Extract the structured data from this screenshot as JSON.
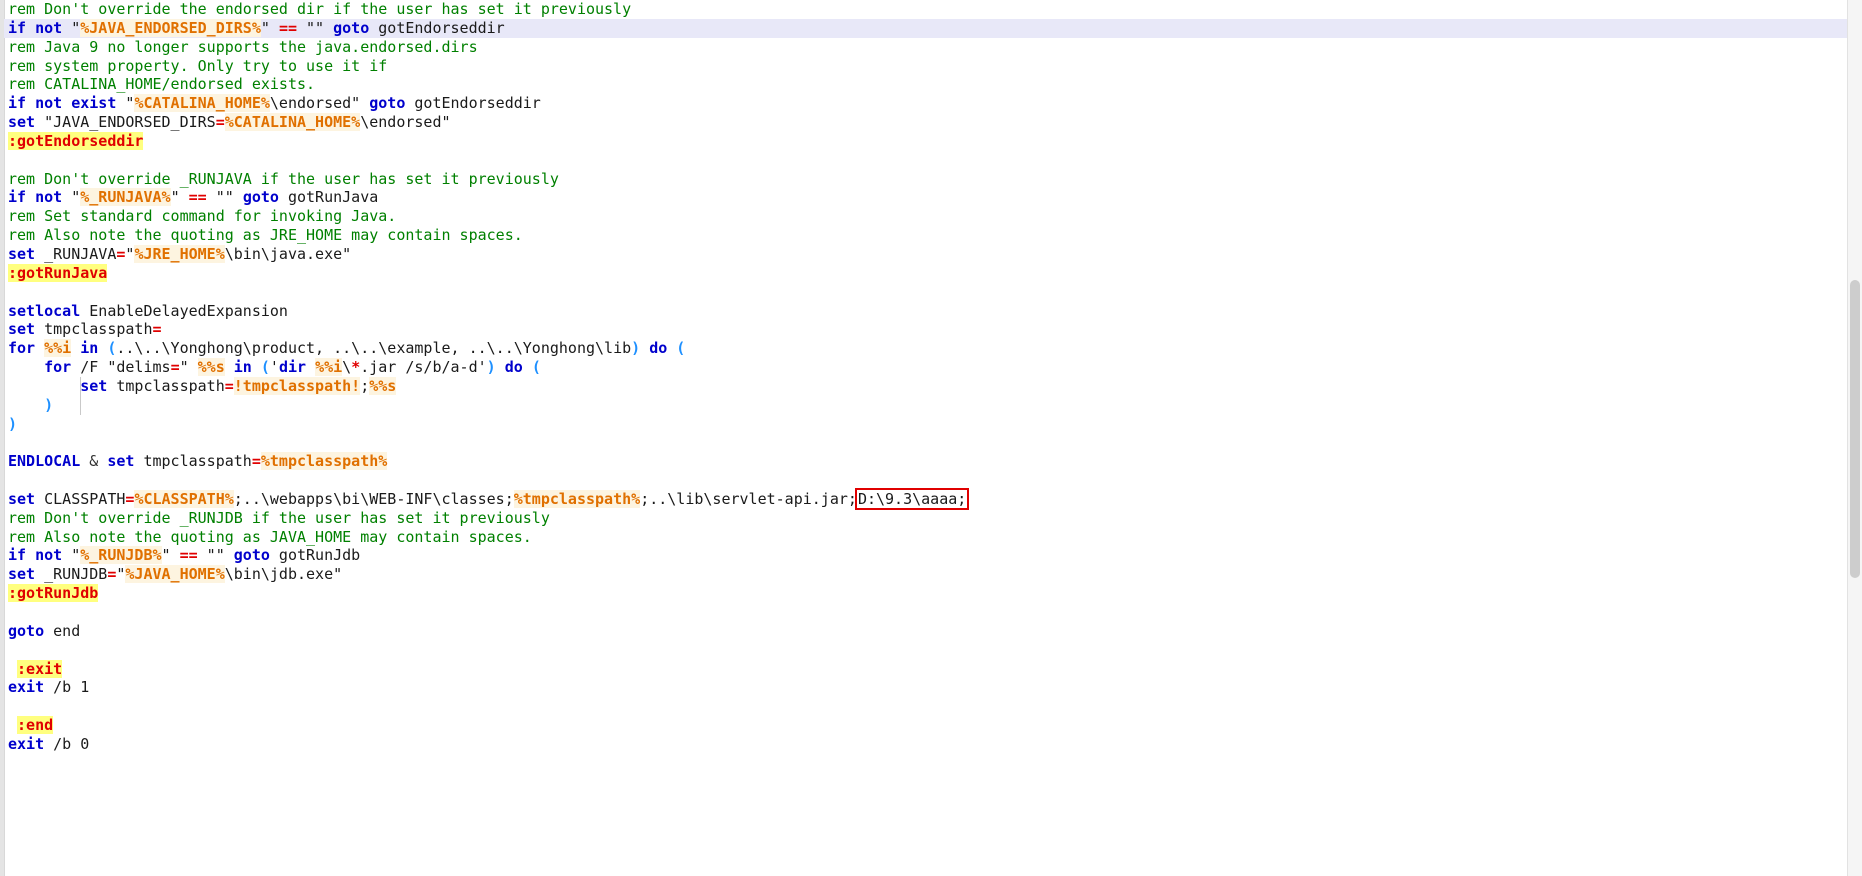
{
  "editor": {
    "language": "batch",
    "filename_hint": "",
    "colors": {
      "keyword": "#0000cc",
      "comment": "#008000",
      "operator": "#e00000",
      "variable": "#e07000",
      "variable_bg": "#fdf4e0",
      "label": "#e00000",
      "label_bg": "#ffff7f",
      "paren": "#1e90ff",
      "plain": "#1a1a1a",
      "current_line_bg": "#e8e8f8",
      "annotation_box": "#e00000",
      "background": "#ffffff",
      "gutter": "#e4e4e4"
    },
    "annotation": {
      "boxed_text": "D:\\9.3\\aaaa;",
      "box_color": "#e00000"
    },
    "scrollbar": {
      "visible": true,
      "thumb_top_pct": 32,
      "thumb_height_pct": 34
    }
  },
  "lines": [
    {
      "id": 1,
      "current": false,
      "tokens": [
        {
          "t": "rem Don't override the endorsed dir if the user has set it previously",
          "c": "t-rem"
        }
      ]
    },
    {
      "id": 2,
      "current": true,
      "tokens": [
        {
          "t": "if",
          "c": "t-kw"
        },
        {
          "t": " ",
          "c": "t-plain"
        },
        {
          "t": "not",
          "c": "t-kw"
        },
        {
          "t": " \"",
          "c": "t-plain"
        },
        {
          "t": "%JAVA_ENDORSED_DIRS%",
          "c": "t-var"
        },
        {
          "t": "\" ",
          "c": "t-plain"
        },
        {
          "t": "==",
          "c": "t-op"
        },
        {
          "t": " \"\" ",
          "c": "t-plain"
        },
        {
          "t": "goto",
          "c": "t-kw"
        },
        {
          "t": " gotEndorseddir",
          "c": "t-plain"
        }
      ]
    },
    {
      "id": 3,
      "current": false,
      "tokens": [
        {
          "t": "rem Java 9 no longer supports the java.endorsed.dirs",
          "c": "t-rem"
        }
      ]
    },
    {
      "id": 4,
      "current": false,
      "tokens": [
        {
          "t": "rem system property. Only try to use it if",
          "c": "t-rem"
        }
      ]
    },
    {
      "id": 5,
      "current": false,
      "tokens": [
        {
          "t": "rem CATALINA_HOME/endorsed exists.",
          "c": "t-rem"
        }
      ]
    },
    {
      "id": 6,
      "current": false,
      "tokens": [
        {
          "t": "if",
          "c": "t-kw"
        },
        {
          "t": " ",
          "c": "t-plain"
        },
        {
          "t": "not",
          "c": "t-kw"
        },
        {
          "t": " ",
          "c": "t-plain"
        },
        {
          "t": "exist",
          "c": "t-kw"
        },
        {
          "t": " \"",
          "c": "t-plain"
        },
        {
          "t": "%CATALINA_HOME%",
          "c": "t-var"
        },
        {
          "t": "\\endorsed\" ",
          "c": "t-plain"
        },
        {
          "t": "goto",
          "c": "t-kw"
        },
        {
          "t": " gotEndorseddir",
          "c": "t-plain"
        }
      ]
    },
    {
      "id": 7,
      "current": false,
      "tokens": [
        {
          "t": "set",
          "c": "t-kw"
        },
        {
          "t": " \"JAVA_ENDORSED_DIRS",
          "c": "t-plain"
        },
        {
          "t": "=",
          "c": "t-op"
        },
        {
          "t": "%CATALINA_HOME%",
          "c": "t-var"
        },
        {
          "t": "\\endorsed\"",
          "c": "t-plain"
        }
      ]
    },
    {
      "id": 8,
      "current": false,
      "tokens": [
        {
          "t": ":gotEndorseddir",
          "c": "t-label"
        }
      ]
    },
    {
      "id": 9,
      "current": false,
      "tokens": []
    },
    {
      "id": 10,
      "current": false,
      "tokens": [
        {
          "t": "rem Don't override _RUNJAVA if the user has set it previously",
          "c": "t-rem"
        }
      ]
    },
    {
      "id": 11,
      "current": false,
      "tokens": [
        {
          "t": "if",
          "c": "t-kw"
        },
        {
          "t": " ",
          "c": "t-plain"
        },
        {
          "t": "not",
          "c": "t-kw"
        },
        {
          "t": " \"",
          "c": "t-plain"
        },
        {
          "t": "%_RUNJAVA%",
          "c": "t-var"
        },
        {
          "t": "\" ",
          "c": "t-plain"
        },
        {
          "t": "==",
          "c": "t-op"
        },
        {
          "t": " \"\" ",
          "c": "t-plain"
        },
        {
          "t": "goto",
          "c": "t-kw"
        },
        {
          "t": " gotRunJava",
          "c": "t-plain"
        }
      ]
    },
    {
      "id": 12,
      "current": false,
      "tokens": [
        {
          "t": "rem Set standard command for invoking Java.",
          "c": "t-rem"
        }
      ]
    },
    {
      "id": 13,
      "current": false,
      "tokens": [
        {
          "t": "rem Also note the quoting as JRE_HOME may contain spaces.",
          "c": "t-rem"
        }
      ]
    },
    {
      "id": 14,
      "current": false,
      "tokens": [
        {
          "t": "set",
          "c": "t-kw"
        },
        {
          "t": " _RUNJAVA",
          "c": "t-plain"
        },
        {
          "t": "=",
          "c": "t-op"
        },
        {
          "t": "\"",
          "c": "t-plain"
        },
        {
          "t": "%JRE_HOME%",
          "c": "t-var"
        },
        {
          "t": "\\bin\\java.exe\"",
          "c": "t-plain"
        }
      ]
    },
    {
      "id": 15,
      "current": false,
      "tokens": [
        {
          "t": ":gotRunJava",
          "c": "t-label"
        }
      ]
    },
    {
      "id": 16,
      "current": false,
      "tokens": []
    },
    {
      "id": 17,
      "current": false,
      "tokens": [
        {
          "t": "setlocal",
          "c": "t-kw"
        },
        {
          "t": " EnableDelayedExpansion",
          "c": "t-plain"
        }
      ]
    },
    {
      "id": 18,
      "current": false,
      "tokens": [
        {
          "t": "set",
          "c": "t-kw"
        },
        {
          "t": " tmpclasspath",
          "c": "t-plain"
        },
        {
          "t": "=",
          "c": "t-op"
        }
      ]
    },
    {
      "id": 19,
      "current": false,
      "tokens": [
        {
          "t": "for",
          "c": "t-kw"
        },
        {
          "t": " ",
          "c": "t-plain"
        },
        {
          "t": "%%i",
          "c": "t-var"
        },
        {
          "t": " ",
          "c": "t-plain"
        },
        {
          "t": "in",
          "c": "t-kw"
        },
        {
          "t": " ",
          "c": "t-plain"
        },
        {
          "t": "(",
          "c": "t-paren"
        },
        {
          "t": "..\\..\\Yonghong\\product, ..\\..\\example, ..\\..\\Yonghong\\lib",
          "c": "t-plain"
        },
        {
          "t": ")",
          "c": "t-paren"
        },
        {
          "t": " ",
          "c": "t-plain"
        },
        {
          "t": "do",
          "c": "t-kw"
        },
        {
          "t": " ",
          "c": "t-plain"
        },
        {
          "t": "(",
          "c": "t-paren"
        }
      ]
    },
    {
      "id": 20,
      "current": false,
      "tokens": [
        {
          "t": "    ",
          "c": "t-plain"
        },
        {
          "t": "for",
          "c": "t-kw"
        },
        {
          "t": " /F \"delims",
          "c": "t-plain"
        },
        {
          "t": "=",
          "c": "t-op"
        },
        {
          "t": "\" ",
          "c": "t-plain"
        },
        {
          "t": "%%s",
          "c": "t-var"
        },
        {
          "t": " ",
          "c": "t-plain"
        },
        {
          "t": "in",
          "c": "t-kw"
        },
        {
          "t": " ",
          "c": "t-plain"
        },
        {
          "t": "(",
          "c": "t-paren"
        },
        {
          "t": "'",
          "c": "t-plain"
        },
        {
          "t": "dir",
          "c": "t-kw"
        },
        {
          "t": " ",
          "c": "t-plain"
        },
        {
          "t": "%%i",
          "c": "t-var"
        },
        {
          "t": "\\",
          "c": "t-plain"
        },
        {
          "t": "*",
          "c": "t-op"
        },
        {
          "t": ".jar /s/b/a-d'",
          "c": "t-plain"
        },
        {
          "t": ")",
          "c": "t-paren"
        },
        {
          "t": " ",
          "c": "t-plain"
        },
        {
          "t": "do",
          "c": "t-kw"
        },
        {
          "t": " ",
          "c": "t-plain"
        },
        {
          "t": "(",
          "c": "t-paren"
        }
      ]
    },
    {
      "id": 21,
      "current": false,
      "tokens": [
        {
          "t": "        ",
          "c": "t-plain"
        },
        {
          "t": "set",
          "c": "t-kw"
        },
        {
          "t": " tmpclasspath",
          "c": "t-plain"
        },
        {
          "t": "=",
          "c": "t-op"
        },
        {
          "t": "!tmpclasspath!",
          "c": "t-var"
        },
        {
          "t": ";",
          "c": "t-plain"
        },
        {
          "t": "%%s",
          "c": "t-var"
        }
      ]
    },
    {
      "id": 22,
      "current": false,
      "tokens": [
        {
          "t": "    ",
          "c": "t-plain"
        },
        {
          "t": ")",
          "c": "t-paren"
        }
      ]
    },
    {
      "id": 23,
      "current": false,
      "tokens": [
        {
          "t": ")",
          "c": "t-paren"
        }
      ]
    },
    {
      "id": 24,
      "current": false,
      "tokens": []
    },
    {
      "id": 25,
      "current": false,
      "tokens": [
        {
          "t": "ENDLOCAL",
          "c": "t-kw"
        },
        {
          "t": " ",
          "c": "t-plain"
        },
        {
          "t": "&",
          "c": "t-amp"
        },
        {
          "t": " ",
          "c": "t-plain"
        },
        {
          "t": "set",
          "c": "t-kw"
        },
        {
          "t": " tmpclasspath",
          "c": "t-plain"
        },
        {
          "t": "=",
          "c": "t-op"
        },
        {
          "t": "%tmpclasspath%",
          "c": "t-var"
        }
      ]
    },
    {
      "id": 26,
      "current": false,
      "tokens": []
    },
    {
      "id": 27,
      "current": false,
      "tokens": [
        {
          "t": "set",
          "c": "t-kw"
        },
        {
          "t": " CLASSPATH",
          "c": "t-plain"
        },
        {
          "t": "=",
          "c": "t-op"
        },
        {
          "t": "%CLASSPATH%",
          "c": "t-var"
        },
        {
          "t": ";..\\webapps\\bi\\WEB-INF\\classes;",
          "c": "t-plain"
        },
        {
          "t": "%tmpclasspath%",
          "c": "t-var"
        },
        {
          "t": ";..\\lib\\servlet-api.jar;",
          "c": "t-plain"
        },
        {
          "t": "D:\\9.3\\aaaa;",
          "c": "t-plain",
          "boxed": true
        }
      ]
    },
    {
      "id": 28,
      "current": false,
      "tokens": [
        {
          "t": "rem Don't override _RUNJDB if the user has set it previously",
          "c": "t-rem"
        }
      ]
    },
    {
      "id": 29,
      "current": false,
      "tokens": [
        {
          "t": "rem Also note the quoting as JAVA_HOME may contain spaces.",
          "c": "t-rem"
        }
      ]
    },
    {
      "id": 30,
      "current": false,
      "tokens": [
        {
          "t": "if",
          "c": "t-kw"
        },
        {
          "t": " ",
          "c": "t-plain"
        },
        {
          "t": "not",
          "c": "t-kw"
        },
        {
          "t": " \"",
          "c": "t-plain"
        },
        {
          "t": "%_RUNJDB%",
          "c": "t-var"
        },
        {
          "t": "\" ",
          "c": "t-plain"
        },
        {
          "t": "==",
          "c": "t-op"
        },
        {
          "t": " \"\" ",
          "c": "t-plain"
        },
        {
          "t": "goto",
          "c": "t-kw"
        },
        {
          "t": " gotRunJdb",
          "c": "t-plain"
        }
      ]
    },
    {
      "id": 31,
      "current": false,
      "tokens": [
        {
          "t": "set",
          "c": "t-kw"
        },
        {
          "t": " _RUNJDB",
          "c": "t-plain"
        },
        {
          "t": "=",
          "c": "t-op"
        },
        {
          "t": "\"",
          "c": "t-plain"
        },
        {
          "t": "%JAVA_HOME%",
          "c": "t-var"
        },
        {
          "t": "\\bin\\jdb.exe\"",
          "c": "t-plain"
        }
      ]
    },
    {
      "id": 32,
      "current": false,
      "tokens": [
        {
          "t": ":gotRunJdb",
          "c": "t-label"
        }
      ]
    },
    {
      "id": 33,
      "current": false,
      "tokens": []
    },
    {
      "id": 34,
      "current": false,
      "tokens": [
        {
          "t": "goto",
          "c": "t-kw"
        },
        {
          "t": " end",
          "c": "t-plain"
        }
      ]
    },
    {
      "id": 35,
      "current": false,
      "tokens": []
    },
    {
      "id": 36,
      "current": false,
      "tokens": [
        {
          "t": " ",
          "c": "t-plain"
        },
        {
          "t": ":exit",
          "c": "t-label"
        }
      ]
    },
    {
      "id": 37,
      "current": false,
      "tokens": [
        {
          "t": "exit",
          "c": "t-kw"
        },
        {
          "t": " /b 1",
          "c": "t-plain"
        }
      ]
    },
    {
      "id": 38,
      "current": false,
      "tokens": []
    },
    {
      "id": 39,
      "current": false,
      "tokens": [
        {
          "t": " ",
          "c": "t-plain"
        },
        {
          "t": ":end",
          "c": "t-label"
        }
      ]
    },
    {
      "id": 40,
      "current": false,
      "tokens": [
        {
          "t": "exit",
          "c": "t-kw"
        },
        {
          "t": " /b 0",
          "c": "t-plain"
        }
      ]
    }
  ]
}
